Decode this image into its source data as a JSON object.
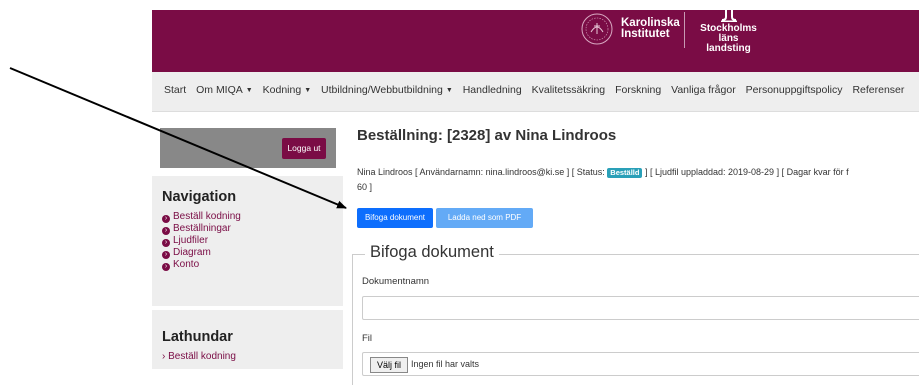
{
  "header": {
    "ki_logo_line1": "Karolinska",
    "ki_logo_line2": "Institutet",
    "sll_logo_line1": "Stockholms läns",
    "sll_logo_line2": "landsting",
    "brand_color": "#7a0c45"
  },
  "nav": {
    "items": [
      {
        "label": "Start",
        "dropdown": false
      },
      {
        "label": "Om MIQA",
        "dropdown": true
      },
      {
        "label": "Kodning",
        "dropdown": true
      },
      {
        "label": "Utbildning/Webbutbildning",
        "dropdown": true
      },
      {
        "label": "Handledning",
        "dropdown": false
      },
      {
        "label": "Kvalitetssäkring",
        "dropdown": false
      },
      {
        "label": "Forskning",
        "dropdown": false
      },
      {
        "label": "Vanliga frågor",
        "dropdown": false
      },
      {
        "label": "Personuppgiftspolicy",
        "dropdown": false
      },
      {
        "label": "Referenser",
        "dropdown": false
      }
    ]
  },
  "sidebar": {
    "logout_label": "Logga ut",
    "navigation_heading": "Navigation",
    "navigation_links": [
      "Beställ kodning",
      "Beställningar",
      "Ljudfiler",
      "Diagram",
      "Konto"
    ],
    "lathundar_heading": "Lathundar",
    "lathundar_link": "Beställ kodning"
  },
  "main": {
    "title": "Beställning: [2328] av Nina Lindroos",
    "info_prefix": "Nina Lindroos [ Användarnamn: nina.lindroos@ki.se ] [ Status: ",
    "status_badge": "Beställd",
    "info_suffix": " ] [ Ljudfil uppladdad: 2019-08-29 ] [ Dagar kvar för f",
    "info_line2": "60 ]",
    "attach_button": "Bifoga dokument",
    "pdf_button": "Ladda ned som PDF",
    "form_legend": "Bifoga dokument",
    "doc_name_label": "Dokumentnamn",
    "doc_name_value": "",
    "file_label": "Fil",
    "choose_file_button": "Välj fil",
    "no_file_text": "Ingen fil har valts"
  }
}
